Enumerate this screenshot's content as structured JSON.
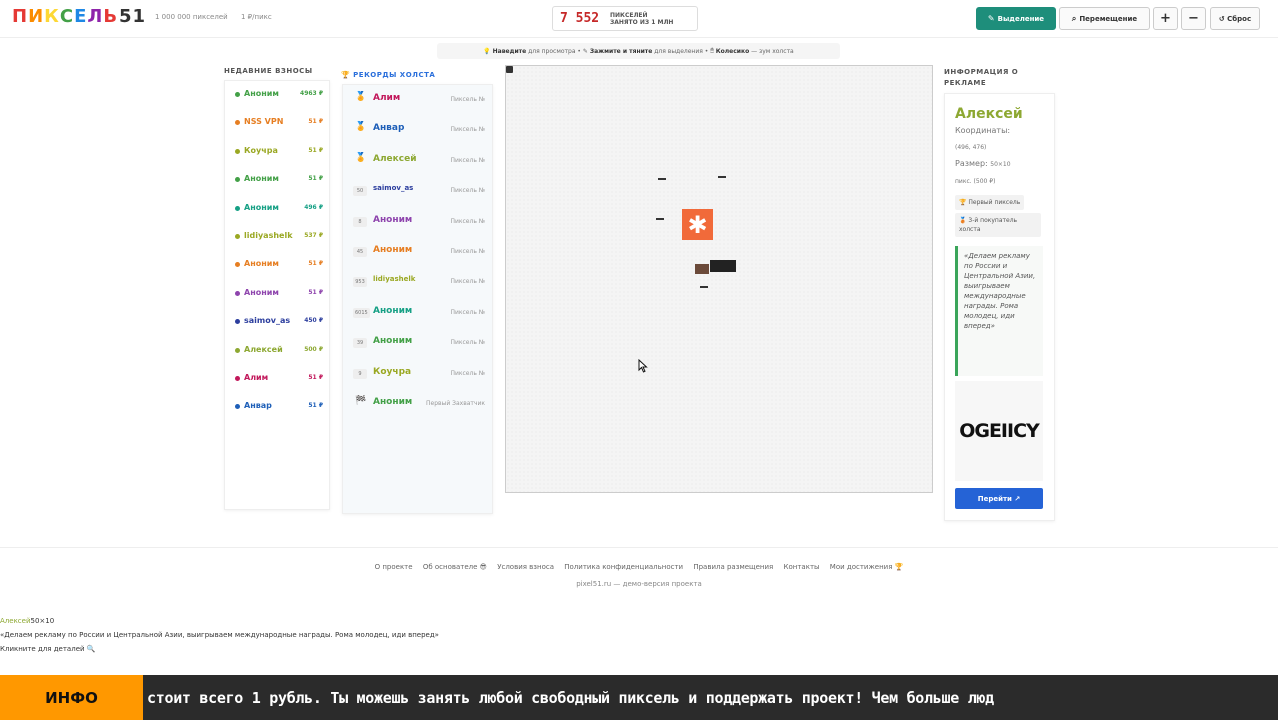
{
  "header": {
    "logo_letters": [
      "П",
      "И",
      "К",
      "С",
      "Е",
      "Л",
      "Ь"
    ],
    "logo_colors": [
      "#e53935",
      "#fb8c00",
      "#fdd835",
      "#43a047",
      "#1e88e5",
      "#8e24aa",
      "#e53935"
    ],
    "logo_number": "51",
    "sub_pixels": "1 000 000 пикселей",
    "sub_price": "1 ₽/пикс",
    "counter_value": "7 552",
    "counter_label_1": "ПИКСЕЛЕЙ",
    "counter_label_2": "ЗАНЯТО ИЗ 1 МЛН",
    "btn_select": "Выделение",
    "btn_move": "Перемещение",
    "btn_zoom_in": "+",
    "btn_zoom_out": "−",
    "btn_reset": "↺ Сброс"
  },
  "hint": {
    "h1_bold": "Наведите",
    "h1": "для просмотра •",
    "h2_bold": "Зажмите и тяните",
    "h2": "для выделения •",
    "h3_bold": "Колесико",
    "h3": "— зум холста"
  },
  "recent": {
    "title": "НЕДАВНИЕ ВЗНОСЫ",
    "items": [
      {
        "name": "Аноним",
        "px": "4963 ₽",
        "color": "#43a047"
      },
      {
        "name": "NSS VPN",
        "px": "51 ₽",
        "color": "#e67e22"
      },
      {
        "name": "Коучра",
        "px": "51 ₽",
        "color": "#9aa823"
      },
      {
        "name": "Аноним",
        "px": "51 ₽",
        "color": "#43a047"
      },
      {
        "name": "Аноним",
        "px": "496 ₽",
        "color": "#16a085"
      },
      {
        "name": "lidiyashelk",
        "px": "537 ₽",
        "color": "#9aa823"
      },
      {
        "name": "Аноним",
        "px": "51 ₽",
        "color": "#e67e22"
      },
      {
        "name": "Аноним",
        "px": "51 ₽",
        "color": "#8e44ad"
      },
      {
        "name": "saimov_as",
        "px": "450 ₽",
        "color": "#2c3e9e"
      },
      {
        "name": "Алексей",
        "px": "500 ₽",
        "color": "#8da832"
      },
      {
        "name": "Алим",
        "px": "51 ₽",
        "color": "#c2185b"
      },
      {
        "name": "Анвар",
        "px": "51 ₽",
        "color": "#1e5fb8"
      }
    ]
  },
  "records": {
    "title": "РЕКОРДЫ ХОЛСТА",
    "items": [
      {
        "badge": "",
        "medal": "🏅",
        "name": "Алим",
        "meta": "Пиксель №",
        "color": "#c2185b"
      },
      {
        "badge": "",
        "medal": "🏅",
        "name": "Анвар",
        "meta": "Пиксель №",
        "color": "#1e5fb8"
      },
      {
        "badge": "",
        "medal": "🏅",
        "name": "Алексей",
        "meta": "Пиксель №",
        "color": "#8da832"
      },
      {
        "badge": "50",
        "medal": "",
        "name": "saimov_as",
        "meta": "Пиксель №",
        "color": "#2c3e9e"
      },
      {
        "badge": "8",
        "medal": "",
        "name": "Аноним",
        "meta": "Пиксель №",
        "color": "#8e44ad"
      },
      {
        "badge": "45",
        "medal": "",
        "name": "Аноним",
        "meta": "Пиксель №",
        "color": "#e67e22"
      },
      {
        "badge": "953",
        "medal": "",
        "name": "lidiyashelk",
        "meta": "Пиксель №",
        "color": "#9aa823"
      },
      {
        "badge": "6015",
        "medal": "",
        "name": "Аноним",
        "meta": "Пиксель №",
        "color": "#16a085"
      },
      {
        "badge": "39",
        "medal": "",
        "name": "Аноним",
        "meta": "Пиксель №",
        "color": "#43a047"
      },
      {
        "badge": "9",
        "medal": "",
        "name": "Коучра",
        "meta": "Пиксель №",
        "color": "#9aa823"
      },
      {
        "badge": "",
        "medal": "🏁",
        "name": "Аноним",
        "meta": "Первый Захватчик",
        "color": "#43a047"
      }
    ]
  },
  "info": {
    "title": "ИНФОРМАЦИЯ О РЕКЛАМЕ",
    "name": "Алексей",
    "coords_label": "Координаты:",
    "coords_value": "(496, 476)",
    "size_label": "Размер:",
    "size_value": "50×10",
    "size_suffix": "пикс. (500 ₽)",
    "chip1": "🏆 Первый пиксель",
    "chip2": "🥉 3-й покупатель холста",
    "quote": "«Делаем рекламу по России и Центральной Азии, выигрываем международные награды. Рома молодец, иди вперед»",
    "ad_logo": "OGEIICY",
    "go_button": "Перейти ↗"
  },
  "footer": {
    "links": [
      "О проекте",
      "Об основателе 😎",
      "Условия взноса",
      "Политика конфиденциальности",
      "Правила размещения",
      "Контакты",
      "Мои достижения 🏆"
    ],
    "sub": "pixel51.ru — демо-версия проекта"
  },
  "tooltip": {
    "name": "Алексей",
    "size": "50×10",
    "quote": "«Делаем рекламу по России и Центральной Азии, выигрываем международные награды. Рома молодец, иди вперед»",
    "hint": "Кликните для деталей 🔍"
  },
  "ticker": {
    "tag": "ИНФО",
    "message": "стоит всего 1 рубль. Ты можешь занять любой свободный пиксель и поддержать проект! Чем больше люд"
  }
}
